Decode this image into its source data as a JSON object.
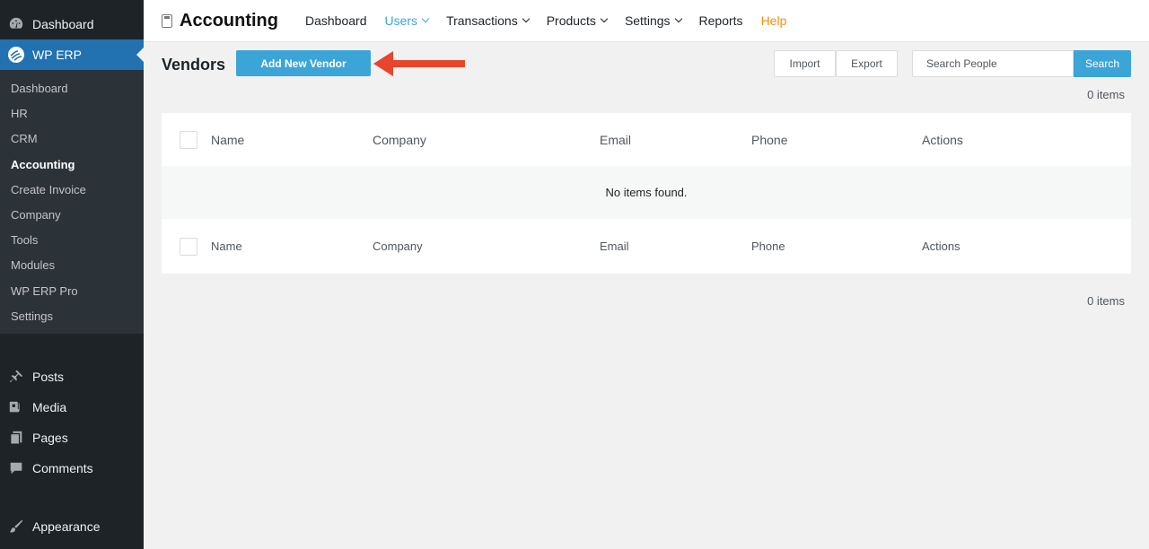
{
  "sidebar": {
    "top_items": [
      {
        "label": "Dashboard",
        "icon": "dashboard-icon"
      },
      {
        "label": "WP ERP",
        "icon": "wp-erp-icon",
        "current": true
      }
    ],
    "submenu": [
      "Dashboard",
      "HR",
      "CRM",
      "Accounting",
      "Create Invoice",
      "Company",
      "Tools",
      "Modules",
      "WP ERP Pro",
      "Settings"
    ],
    "submenu_active": "Accounting",
    "bottom_items": [
      {
        "label": "Posts",
        "icon": "pin-icon"
      },
      {
        "label": "Media",
        "icon": "media-icon"
      },
      {
        "label": "Pages",
        "icon": "pages-icon"
      },
      {
        "label": "Comments",
        "icon": "comments-icon"
      },
      {
        "label": "Appearance",
        "icon": "brush-icon"
      }
    ]
  },
  "topnav": {
    "title": "Accounting",
    "items": [
      {
        "label": "Dashboard",
        "dropdown": false
      },
      {
        "label": "Users",
        "dropdown": true
      },
      {
        "label": "Transactions",
        "dropdown": true
      },
      {
        "label": "Products",
        "dropdown": true
      },
      {
        "label": "Settings",
        "dropdown": true
      },
      {
        "label": "Reports",
        "dropdown": false
      },
      {
        "label": "Help",
        "dropdown": false
      }
    ],
    "active": "Users",
    "colors": {
      "active": "#3ba5d8",
      "help": "#f0900c"
    }
  },
  "page": {
    "title": "Vendors",
    "add_button": "Add New Vendor",
    "import_button": "Import",
    "export_button": "Export",
    "search_placeholder": "Search People",
    "search_button": "Search",
    "count_top": "0 items",
    "count_bottom": "0 items"
  },
  "table": {
    "columns": [
      "Name",
      "Company",
      "Email",
      "Phone",
      "Actions"
    ],
    "empty_message": "No items found."
  },
  "colors": {
    "accent": "#3ba5d8",
    "sidebar_bg": "#1d2327",
    "sidebar_current": "#2271b1",
    "arrow": "#e8452c"
  }
}
